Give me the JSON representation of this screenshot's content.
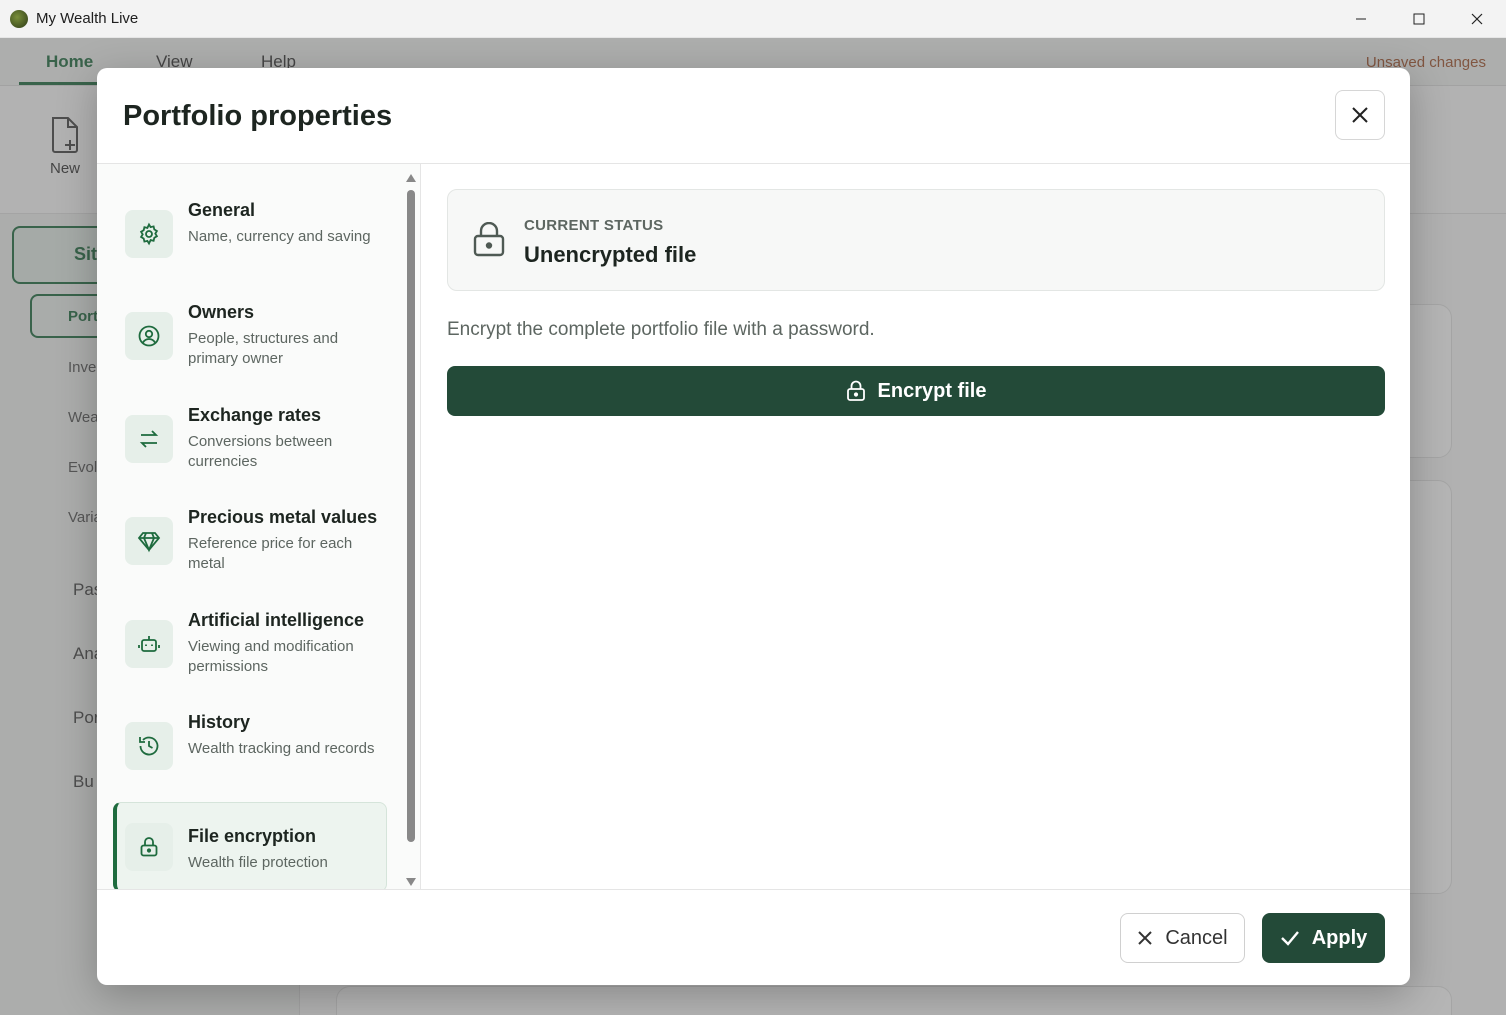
{
  "window": {
    "title": "My Wealth Live",
    "minimize_icon": "minimize-icon",
    "maximize_icon": "maximize-icon",
    "close_icon": "close-icon"
  },
  "background": {
    "tabs": [
      "Home",
      "View",
      "Help"
    ],
    "unsaved": "Unsaved changes",
    "new_label": "New",
    "sidebar_main": "Sit",
    "sidebar_sub": "Port",
    "sidebar_items": [
      "Inve",
      "Wea",
      "Evol",
      "Varia"
    ],
    "sidebar_big_items": [
      "Pas",
      "Ana",
      "Por",
      "Bu"
    ]
  },
  "modal": {
    "title": "Portfolio properties",
    "nav": [
      {
        "title": "General",
        "desc": "Name, currency and saving",
        "icon": "gear-icon"
      },
      {
        "title": "Owners",
        "desc": "People, structures and primary owner",
        "icon": "user-circle-icon"
      },
      {
        "title": "Exchange rates",
        "desc": "Conversions between currencies",
        "icon": "exchange-arrows-icon"
      },
      {
        "title": "Precious metal values",
        "desc": "Reference price for each metal",
        "icon": "diamond-icon"
      },
      {
        "title": "Artificial intelligence",
        "desc": "Viewing and modification permissions",
        "icon": "robot-icon"
      },
      {
        "title": "History",
        "desc": "Wealth tracking and records",
        "icon": "history-icon"
      },
      {
        "title": "File encryption",
        "desc": "Wealth file protection",
        "icon": "lock-icon"
      }
    ],
    "active_nav": "File encryption",
    "status": {
      "label": "CURRENT STATUS",
      "value": "Unencrypted file"
    },
    "encrypt_desc": "Encrypt the complete portfolio file with a password.",
    "encrypt_button": "Encrypt file",
    "cancel": "Cancel",
    "apply": "Apply"
  },
  "colors": {
    "accent": "#1e6b3e",
    "primary_button": "#234a38"
  }
}
